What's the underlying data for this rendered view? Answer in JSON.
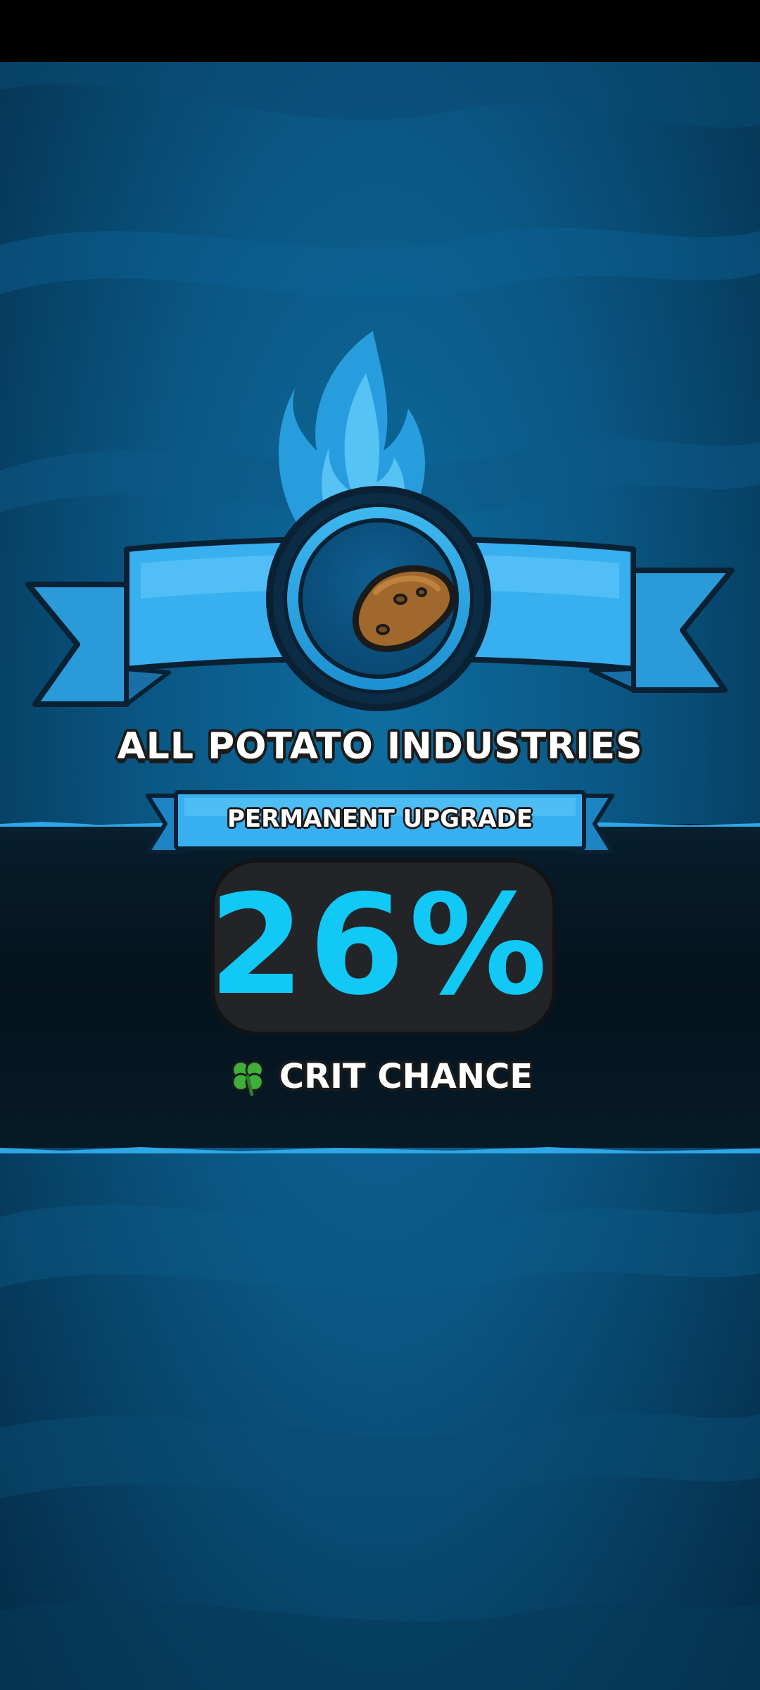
{
  "reward": {
    "title": "ALL POTATO INDUSTRIES",
    "subtitle": "PERMANENT UPGRADE",
    "value": "26%",
    "stat_label": "CRIT CHANCE",
    "icon": "potato-icon",
    "stat_icon": "clover-icon"
  },
  "colors": {
    "accent": "#12c8f5",
    "ribbon": "#35aef0",
    "background": "#0a5682",
    "band": "#04131d",
    "text": "#ffffff",
    "outline": "#1b1b1b"
  }
}
